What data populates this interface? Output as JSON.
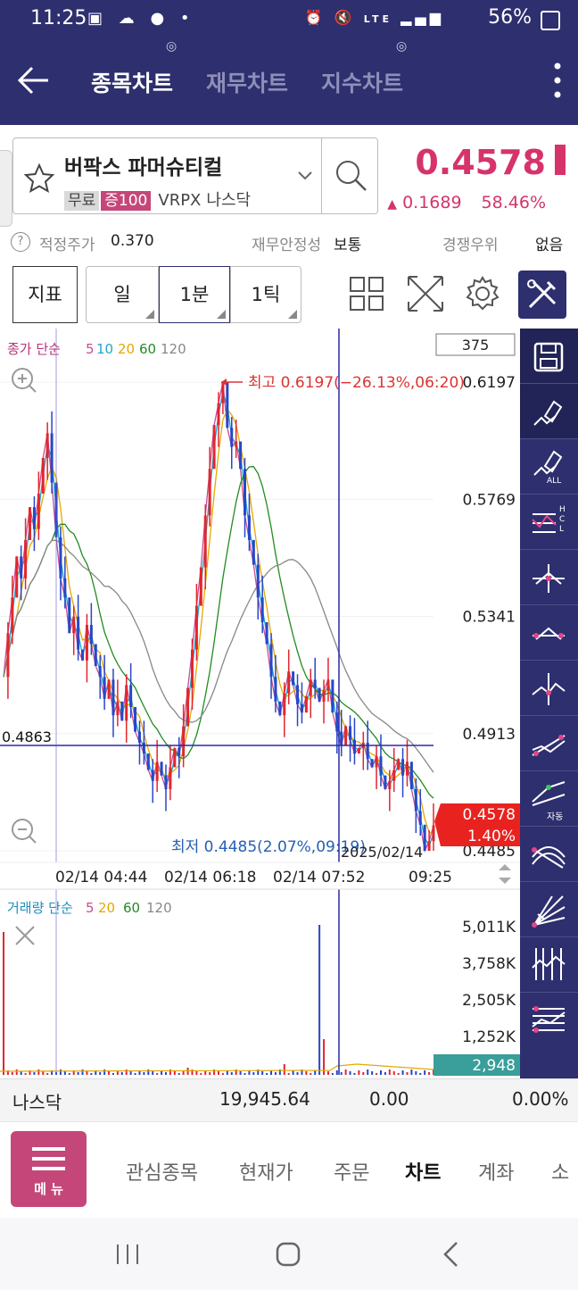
{
  "status_bar": {
    "time": "11:25",
    "battery": "56%",
    "signal": "LTE"
  },
  "app_bar": {
    "tabs": [
      {
        "label": "종목차트",
        "active": true
      },
      {
        "label": "재무차트",
        "active": false
      },
      {
        "label": "지수차트",
        "active": false
      }
    ]
  },
  "stock": {
    "name": "버팍스 파머슈티컬",
    "tags": [
      "무료",
      "증100"
    ],
    "ticker": "VRPX",
    "market": "나스닥",
    "price": "0.4578",
    "change": "0.1689",
    "change_pct": "58.46%"
  },
  "info": {
    "fair_label": "적정주가",
    "fair_value": "0.370",
    "fin_label": "재무안정성",
    "fin_value": "보통",
    "comp_label": "경쟁우위",
    "comp_value": "없음"
  },
  "toolbar": {
    "indicator": "지표",
    "period": "일",
    "minute": "1분",
    "tick": "1틱"
  },
  "chart_data": {
    "type": "line",
    "title": "",
    "price_legend": {
      "label": "종가 단순",
      "periods": [
        "5",
        "10",
        "20",
        "60",
        "120"
      ]
    },
    "volume_legend": {
      "label": "거래량 단순",
      "periods": [
        "5",
        "20",
        "60",
        "120"
      ]
    },
    "bars_count": "375",
    "y_ticks": [
      "0.6197",
      "0.5769",
      "0.5341",
      "0.4913",
      "0.4485"
    ],
    "x_ticks": [
      "02/14 04:44",
      "02/14 06:18",
      "02/14 07:52",
      "09:25"
    ],
    "date_label": "2025/02/14",
    "high_label": "최고 0.6197(−26.13%,06:20)",
    "low_label": "최저 0.4485(2.07%,09:19)",
    "crosshair_value": "0.4863",
    "current_price": "0.4578",
    "current_pct": "1.40%",
    "vol_ticks": [
      "5,011K",
      "3,758K",
      "2,505K",
      "1,252K"
    ],
    "current_volume": "2,948",
    "ylim": [
      0.4485,
      0.6197
    ],
    "close_series": [
      0.512,
      0.528,
      0.541,
      0.556,
      0.548,
      0.562,
      0.574,
      0.566,
      0.579,
      0.592,
      0.601,
      0.583,
      0.563,
      0.548,
      0.541,
      0.528,
      0.534,
      0.522,
      0.518,
      0.531,
      0.524,
      0.516,
      0.512,
      0.504,
      0.511,
      0.498,
      0.503,
      0.496,
      0.509,
      0.501,
      0.492,
      0.488,
      0.484,
      0.478,
      0.474,
      0.481,
      0.476,
      0.471,
      0.479,
      0.486,
      0.483,
      0.494,
      0.508,
      0.522,
      0.538,
      0.552,
      0.571,
      0.588,
      0.604,
      0.612,
      0.6197,
      0.603,
      0.596,
      0.598,
      0.588,
      0.571,
      0.562,
      0.553,
      0.541,
      0.532,
      0.524,
      0.512,
      0.503,
      0.498,
      0.506,
      0.514,
      0.509,
      0.502,
      0.499,
      0.505,
      0.511,
      0.508,
      0.503,
      0.507,
      0.511,
      0.499,
      0.492,
      0.487,
      0.494,
      0.489,
      0.484,
      0.486,
      0.488,
      0.482,
      0.479,
      0.483,
      0.476,
      0.471,
      0.474,
      0.478,
      0.482,
      0.476,
      0.481,
      0.471,
      0.463,
      0.458,
      0.4485,
      0.452,
      0.4578
    ]
  },
  "right_panel": {
    "auto_label": "자동",
    "all_label": "ALL",
    "hcl": [
      "H",
      "C",
      "L"
    ]
  },
  "index_bar": {
    "name": "나스닥",
    "value": "19,945.64",
    "change": "0.00",
    "pct": "0.00%"
  },
  "nav": {
    "menu_label": "메 뉴",
    "items": [
      {
        "label": "관심종목",
        "active": false
      },
      {
        "label": "현재가",
        "active": false
      },
      {
        "label": "주문",
        "active": false
      },
      {
        "label": "차트",
        "active": true
      },
      {
        "label": "계좌",
        "active": false
      },
      {
        "label": "소",
        "active": false
      }
    ]
  }
}
